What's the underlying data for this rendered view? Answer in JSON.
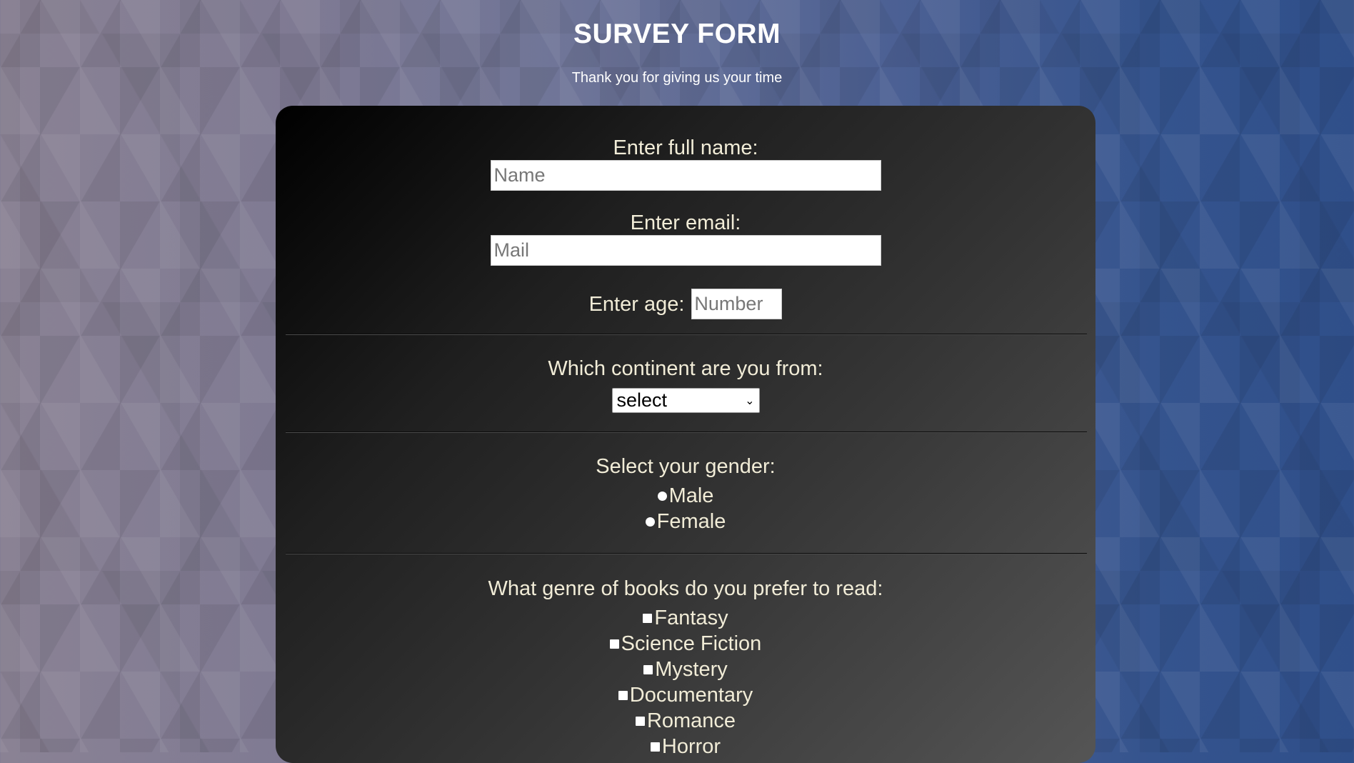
{
  "page": {
    "title": "SURVEY FORM",
    "subtitle": "Thank you for giving us your time"
  },
  "form": {
    "name": {
      "label": "Enter full name:",
      "placeholder": "Name",
      "value": ""
    },
    "email": {
      "label": "Enter email:",
      "placeholder": "Mail",
      "value": ""
    },
    "age": {
      "label": "Enter age:",
      "placeholder": "Number",
      "value": ""
    },
    "continent": {
      "label": "Which continent are you from:",
      "selected": "select"
    },
    "gender": {
      "label": "Select your gender:",
      "options": [
        "Male",
        "Female"
      ]
    },
    "genre": {
      "label": "What genre of books do you prefer to read:",
      "options": [
        "Fantasy",
        "Science Fiction",
        "Mystery",
        "Documentary",
        "Romance",
        "Horror"
      ]
    }
  },
  "colors": {
    "label_text": "#f1ecd7",
    "card_dark": "#000000",
    "card_light": "#555555"
  }
}
